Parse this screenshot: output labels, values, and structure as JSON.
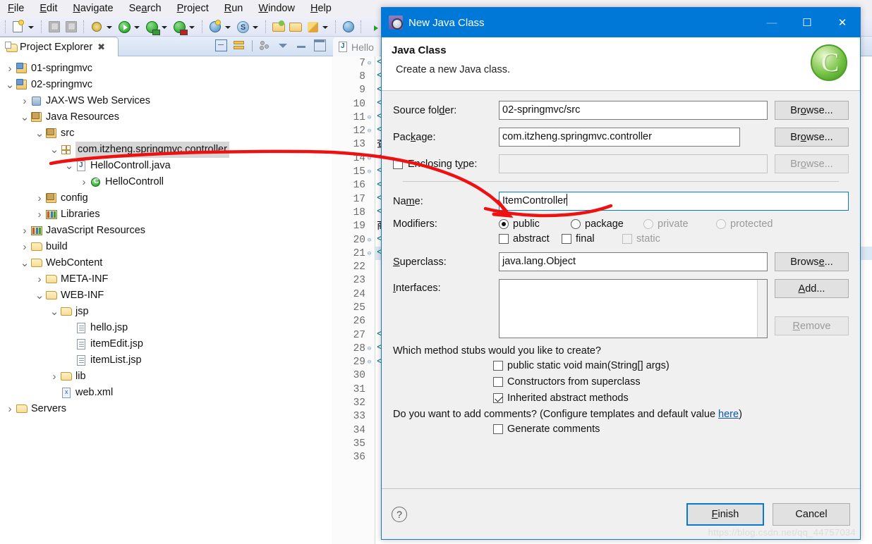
{
  "app": {
    "menu": [
      "File",
      "Edit",
      "Navigate",
      "Search",
      "Project",
      "Run",
      "Window",
      "Help"
    ],
    "toolbar_icons": [
      "new-document-icon",
      "dropdown-arrow-icon",
      "save-icon",
      "save-all-icon",
      "debug-icon",
      "dropdown-arrow-icon",
      "run-icon",
      "dropdown-arrow-icon",
      "run-server-icon",
      "dropdown-arrow-icon",
      "run-profile-icon",
      "dropdown-arrow-icon",
      "new-web-project-icon",
      "dropdown-arrow-icon",
      "spring-icon",
      "dropdown-arrow-icon",
      "open-type-icon",
      "open-resource-icon",
      "marker-icon",
      "dropdown-arrow-icon",
      "globe-icon",
      "external-browser-icon",
      "console-icon"
    ]
  },
  "project_explorer": {
    "tab_label": "Project Explorer",
    "tab_icon": "project-explorer-icon",
    "close_icon": "close-icon",
    "toolbar_icons": [
      "collapse-all-icon",
      "link-with-editor-icon",
      "view-menu-icon",
      "filter-icon",
      "minimize-icon",
      "maximize-icon"
    ],
    "tree": [
      {
        "label": "01-springmvc",
        "indent": 0,
        "twisty": ">",
        "icon": "project-icon",
        "selected": false
      },
      {
        "label": "02-springmvc",
        "indent": 0,
        "twisty": "v",
        "icon": "project-icon",
        "selected": false
      },
      {
        "label": "JAX-WS Web Services",
        "indent": 1,
        "twisty": ">",
        "icon": "web-services-icon",
        "selected": false
      },
      {
        "label": "Java Resources",
        "indent": 1,
        "twisty": "v",
        "icon": "java-resources-icon",
        "selected": false
      },
      {
        "label": "src",
        "indent": 2,
        "twisty": "v",
        "icon": "source-folder-icon",
        "selected": false
      },
      {
        "label": "com.itzheng.springmvc.controller",
        "indent": 3,
        "twisty": "v",
        "icon": "package-icon",
        "selected": true
      },
      {
        "label": "HelloControll.java",
        "indent": 4,
        "twisty": "v",
        "icon": "java-file-icon",
        "selected": false
      },
      {
        "label": "HelloControll",
        "indent": 5,
        "twisty": ">",
        "icon": "class-icon",
        "selected": false
      },
      {
        "label": "config",
        "indent": 2,
        "twisty": ">",
        "icon": "source-folder-icon",
        "selected": false
      },
      {
        "label": "Libraries",
        "indent": 2,
        "twisty": ">",
        "icon": "libraries-icon",
        "selected": false
      },
      {
        "label": "JavaScript Resources",
        "indent": 1,
        "twisty": ">",
        "icon": "libraries-icon",
        "selected": false
      },
      {
        "label": "build",
        "indent": 1,
        "twisty": ">",
        "icon": "folder-icon",
        "selected": false
      },
      {
        "label": "WebContent",
        "indent": 1,
        "twisty": "v",
        "icon": "folder-icon",
        "selected": false
      },
      {
        "label": "META-INF",
        "indent": 2,
        "twisty": ">",
        "icon": "folder-icon",
        "selected": false
      },
      {
        "label": "WEB-INF",
        "indent": 2,
        "twisty": "v",
        "icon": "folder-icon",
        "selected": false
      },
      {
        "label": "jsp",
        "indent": 3,
        "twisty": "v",
        "icon": "folder-icon",
        "selected": false
      },
      {
        "label": "hello.jsp",
        "indent": 4,
        "twisty": "",
        "icon": "jsp-file-icon",
        "selected": false
      },
      {
        "label": "itemEdit.jsp",
        "indent": 4,
        "twisty": "",
        "icon": "jsp-file-icon",
        "selected": false
      },
      {
        "label": "itemList.jsp",
        "indent": 4,
        "twisty": "",
        "icon": "jsp-file-icon",
        "selected": false
      },
      {
        "label": "lib",
        "indent": 3,
        "twisty": ">",
        "icon": "folder-icon",
        "selected": false
      },
      {
        "label": "web.xml",
        "indent": 3,
        "twisty": "",
        "icon": "xml-file-icon",
        "selected": false
      },
      {
        "label": "Servers",
        "indent": 0,
        "twisty": ">",
        "icon": "folder-icon",
        "selected": false
      }
    ]
  },
  "editor": {
    "tab_label": "Hello",
    "tab_icon": "jsp-file-icon",
    "first_line": 7,
    "lines": [
      {
        "n": 7,
        "fold": "⊖",
        "code": "<h",
        "cjk": false,
        "sel": false
      },
      {
        "n": 8,
        "fold": "",
        "code": "<m",
        "cjk": false,
        "sel": false
      },
      {
        "n": 9,
        "fold": "",
        "code": "<t",
        "cjk": false,
        "sel": false
      },
      {
        "n": 10,
        "fold": "",
        "code": "</",
        "cjk": false,
        "sel": false
      },
      {
        "n": 11,
        "fold": "⊖",
        "code": "<b",
        "cjk": false,
        "sel": false
      },
      {
        "n": 12,
        "fold": "⊖",
        "code": "<t",
        "cjk": false,
        "sel": false
      },
      {
        "n": 13,
        "fold": "",
        "code": "查",
        "cjk": true,
        "sel": false
      },
      {
        "n": 14,
        "fold": "⊖",
        "code": "<t",
        "cjk": false,
        "sel": false
      },
      {
        "n": 15,
        "fold": "⊖",
        "code": "<t",
        "cjk": false,
        "sel": false
      },
      {
        "n": 16,
        "fold": "",
        "code": "<t",
        "cjk": false,
        "sel": false
      },
      {
        "n": 17,
        "fold": "",
        "code": "</",
        "cjk": false,
        "sel": false
      },
      {
        "n": 18,
        "fold": "",
        "code": "</",
        "cjk": false,
        "sel": false
      },
      {
        "n": 19,
        "fold": "",
        "code": "商",
        "cjk": true,
        "sel": false
      },
      {
        "n": 20,
        "fold": "⊖",
        "code": "<t",
        "cjk": false,
        "sel": false
      },
      {
        "n": 21,
        "fold": "⊖",
        "code": "<t",
        "cjk": false,
        "sel": true
      },
      {
        "n": 22,
        "fold": "",
        "code": "",
        "cjk": false,
        "sel": false
      },
      {
        "n": 23,
        "fold": "",
        "code": "",
        "cjk": false,
        "sel": false
      },
      {
        "n": 24,
        "fold": "",
        "code": "",
        "cjk": false,
        "sel": false
      },
      {
        "n": 25,
        "fold": "",
        "code": "",
        "cjk": false,
        "sel": false
      },
      {
        "n": 26,
        "fold": "",
        "code": "",
        "cjk": false,
        "sel": false
      },
      {
        "n": 27,
        "fold": "",
        "code": "</",
        "cjk": false,
        "sel": false
      },
      {
        "n": 28,
        "fold": "⊖",
        "code": "<c",
        "cjk": false,
        "sel": false
      },
      {
        "n": 29,
        "fold": "⊖",
        "code": "<t",
        "cjk": false,
        "sel": false
      },
      {
        "n": 30,
        "fold": "",
        "code": "",
        "cjk": false,
        "sel": false
      },
      {
        "n": 31,
        "fold": "",
        "code": "",
        "cjk": false,
        "sel": false
      },
      {
        "n": 32,
        "fold": "",
        "code": "",
        "cjk": false,
        "sel": false
      },
      {
        "n": 33,
        "fold": "",
        "code": "",
        "cjk": false,
        "sel": false
      },
      {
        "n": 34,
        "fold": "",
        "code": "",
        "cjk": false,
        "sel": false
      },
      {
        "n": 35,
        "fold": "",
        "code": "",
        "cjk": false,
        "sel": false
      },
      {
        "n": 36,
        "fold": "",
        "code": "",
        "cjk": false,
        "sel": false
      }
    ]
  },
  "dialog": {
    "title": "New Java Class",
    "title_icon": "java-class-wizard-icon",
    "minimize_label": "—",
    "maximize_label": "☐",
    "close_label": "✕",
    "heading": "Java Class",
    "subheading": "Create a new Java class.",
    "banner_icon": "java-class-banner-icon",
    "source_folder": {
      "label": "Source folder:",
      "label_pre": "Source fol",
      "label_mn": "d",
      "label_post": "er:",
      "value": "02-springmvc/src",
      "browse_pre": "Br",
      "browse_mn": "o",
      "browse_post": "wse..."
    },
    "package": {
      "label_pre": "Pac",
      "label_mn": "k",
      "label_post": "age:",
      "value": "com.itzheng.springmvc.controller",
      "browse_pre": "Br",
      "browse_mn": "o",
      "browse_post": "wse..."
    },
    "enclosing_type": {
      "label_pre": "Enclosing t",
      "label_mn": "y",
      "label_post": "pe:",
      "value": "",
      "checked": false,
      "browse_pre": "Br",
      "browse_mn": "o",
      "browse_post": "wse...",
      "browse_disabled": true
    },
    "name": {
      "label_pre": "Na",
      "label_mn": "m",
      "label_post": "e:",
      "value": "ItemController",
      "focused": true
    },
    "modifiers": {
      "label": "Modifiers:",
      "radios": [
        {
          "pre": "",
          "mn": "p",
          "post": "ublic",
          "checked": true,
          "disabled": false
        },
        {
          "pre": "pa",
          "mn": "c",
          "post": "kage",
          "checked": false,
          "disabled": false
        },
        {
          "pre": "pri",
          "mn": "v",
          "post": "ate",
          "checked": false,
          "disabled": true
        },
        {
          "pre": "pro",
          "mn": "t",
          "post": "ected",
          "checked": false,
          "disabled": true
        }
      ],
      "checks": [
        {
          "pre": "abs",
          "mn": "t",
          "post": "ract",
          "checked": false,
          "disabled": false
        },
        {
          "pre": "fina",
          "mn": "l",
          "post": "",
          "checked": false,
          "disabled": false
        },
        {
          "pre": "stati",
          "mn": "c",
          "post": "",
          "checked": false,
          "disabled": true
        }
      ]
    },
    "superclass": {
      "label_pre": "",
      "label_mn": "S",
      "label_post": "uperclass:",
      "value": "java.lang.Object",
      "browse_pre": "Brows",
      "browse_mn": "e",
      "browse_post": "..."
    },
    "interfaces": {
      "label_pre": "",
      "label_mn": "I",
      "label_post": "nterfaces:",
      "value": "",
      "add_pre": "",
      "add_mn": "A",
      "add_post": "dd...",
      "remove_pre": "",
      "remove_mn": "R",
      "remove_post": "emove",
      "remove_disabled": true
    },
    "stubs_question": "Which method stubs would you like to create?",
    "stubs": [
      {
        "pre": "public static ",
        "mn": "v",
        "post": "oid main(String[] args)",
        "checked": false
      },
      {
        "pre": "Constr",
        "mn": "u",
        "post": "ctors from superclass",
        "checked": false
      },
      {
        "pre": "In",
        "mn": "h",
        "post": "erited abstract methods",
        "checked": true
      }
    ],
    "comments_question_pre": "Do you want to add comments? (Configure templates and default value ",
    "comments_link": "here",
    "comments_question_post": ")",
    "generate_comments": {
      "pre": "",
      "mn": "G",
      "post": "enerate comments",
      "checked": false
    },
    "help_icon": "help-icon",
    "finish": {
      "pre": "",
      "mn": "F",
      "post": "inish"
    },
    "cancel": "Cancel"
  },
  "watermark": "https://blog.csdn.net/qq_44757034",
  "annotation": {
    "color": "#ee1111",
    "description": "red-hand-drawn-arrow"
  }
}
